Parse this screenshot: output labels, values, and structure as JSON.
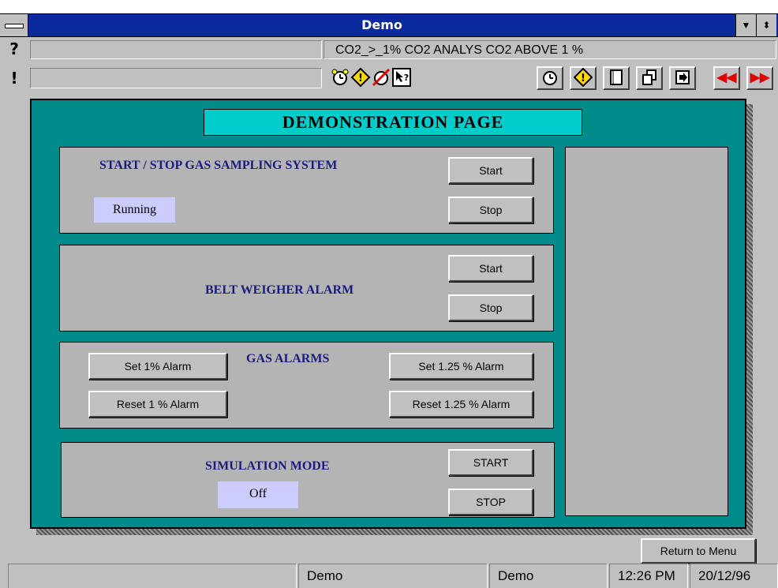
{
  "window": {
    "title": "Demo"
  },
  "alarm_bar": {
    "help_char": "?",
    "alert_char": "!",
    "current_alarm": "CO2_>_1%  CO2 ANALYS CO2 ABOVE 1 %",
    "small_icons": [
      "alarm-clock-icon",
      "warning-icon",
      "alarm-off-icon",
      "help-pointer-icon"
    ],
    "toolbar_icons": [
      "alarm-clock-icon",
      "warning-icon",
      "document-icon",
      "copy-windows-icon",
      "exit-icon",
      "rewind-icon",
      "fast-forward-icon"
    ]
  },
  "page": {
    "title": "DEMONSTRATION  PAGE",
    "gas_sampling": {
      "label": "START / STOP  GAS  SAMPLING  SYSTEM",
      "start": "Start",
      "stop": "Stop",
      "status": "Running"
    },
    "belt_weigher": {
      "label": "BELT WEIGHER ALARM",
      "start": "Start",
      "stop": "Stop"
    },
    "gas_alarms": {
      "label": "GAS  ALARMS",
      "set_1": "Set 1% Alarm",
      "reset_1": "Reset 1 % Alarm",
      "set_125": "Set 1.25 % Alarm",
      "reset_125": "Reset 1.25 % Alarm"
    },
    "simulation": {
      "label": "SIMULATION MODE",
      "start": "START",
      "stop": "STOP",
      "status": "Off"
    }
  },
  "return_button": "Return to Menu",
  "statusbar": {
    "cell1": "",
    "cell2": "Demo",
    "cell3": "Demo",
    "time": "12:26 PM",
    "date": "20/12/96"
  },
  "colors": {
    "title_bar": "#0b2a9e",
    "panel": "#008b8b",
    "page_title_bg": "#00cccc",
    "section": "#b4b4b4",
    "status_bg": "#ccccff",
    "label_text": "#1a1a80"
  }
}
